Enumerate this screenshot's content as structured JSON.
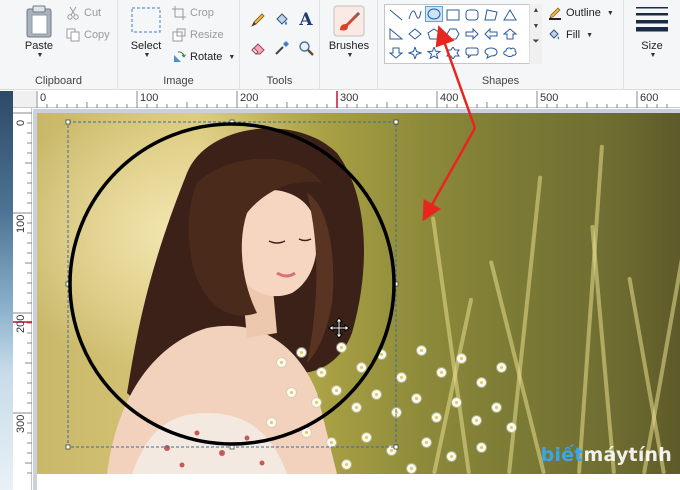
{
  "ribbon": {
    "clipboard": {
      "paste_label": "Paste",
      "cut_label": "Cut",
      "copy_label": "Copy",
      "group_label": "Clipboard"
    },
    "image": {
      "select_label": "Select",
      "crop_label": "Crop",
      "resize_label": "Resize",
      "rotate_label": "Rotate",
      "group_label": "Image"
    },
    "tools": {
      "group_label": "Tools",
      "text_tool_glyph": "A"
    },
    "brushes": {
      "label": "Brushes"
    },
    "shapes": {
      "group_label": "Shapes",
      "outline_label": "Outline",
      "fill_label": "Fill",
      "selected_shape": "oval"
    },
    "size": {
      "label": "Size"
    }
  },
  "ruler": {
    "horizontal_ticks": [
      "0",
      "100",
      "200",
      "300",
      "400",
      "500",
      "600"
    ],
    "vertical_ticks": [
      "0",
      "100",
      "200",
      "300"
    ]
  },
  "watermark": {
    "part1": "biết",
    "part2": "máytính"
  },
  "colors": {
    "accent": "#5fa5dc",
    "arrow": "#e8251f",
    "oval_stroke": "#000000"
  }
}
